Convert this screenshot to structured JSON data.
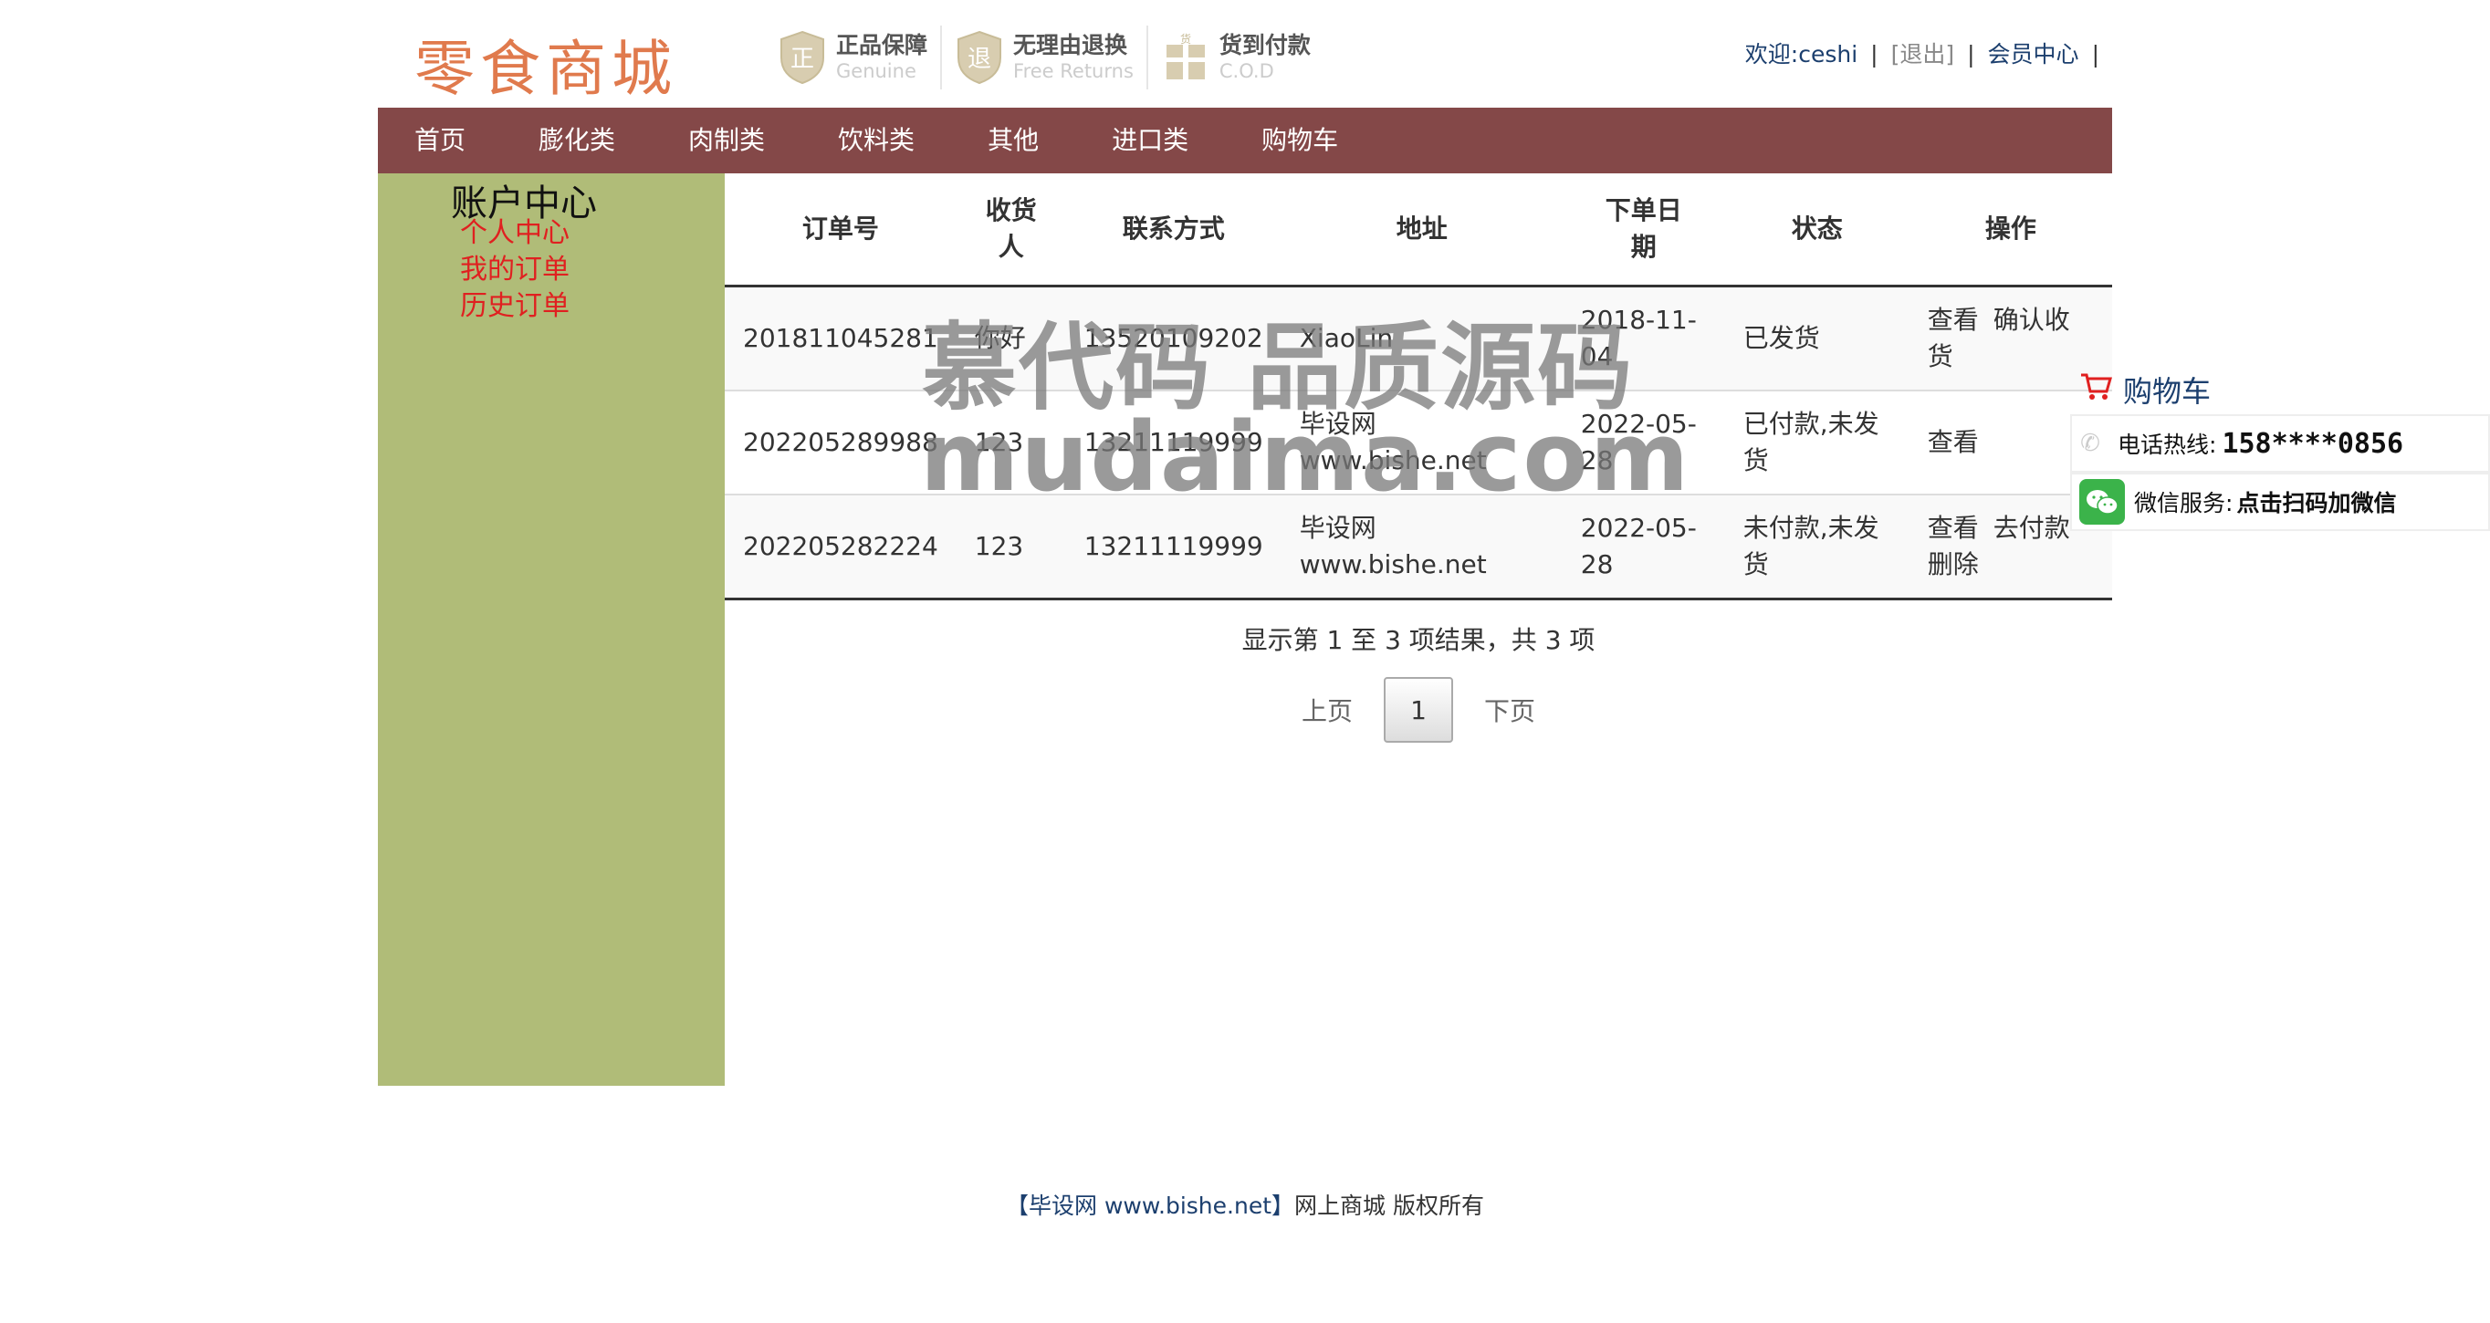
{
  "header": {
    "logo": "零食商城",
    "badges": [
      {
        "glyph": "正",
        "title": "正品保障",
        "sub": "Genuine"
      },
      {
        "glyph": "退",
        "title": "无理由退换",
        "sub": "Free Returns"
      },
      {
        "glyph": "货",
        "title": "货到付款",
        "sub": "C.O.D"
      }
    ],
    "welcome": "欢迎:ceshi",
    "logout": "[退出]",
    "member_center": "会员中心"
  },
  "nav": [
    "首页",
    "膨化类",
    "肉制类",
    "饮料类",
    "其他",
    "进口类",
    "购物车"
  ],
  "sidebar": {
    "title": "账户中心",
    "links": [
      "个人中心",
      "我的订单",
      "历史订单"
    ]
  },
  "table": {
    "headers": [
      "订单号",
      "收货人",
      "联系方式",
      "地址",
      "下单日期",
      "状态",
      "操作"
    ],
    "rows": [
      {
        "order_no": "201811045281",
        "receiver": "你好",
        "phone": "13520109202",
        "address": "XiaoLin",
        "date": "2018-11-04",
        "status": "已发货",
        "ops": [
          "查看",
          "确认收货"
        ]
      },
      {
        "order_no": "202205289988",
        "receiver": "123",
        "phone": "13211119999",
        "address": "毕设网 www.bishe.net",
        "date": "2022-05-28",
        "status": "已付款,未发货",
        "ops": [
          "查看"
        ]
      },
      {
        "order_no": "202205282224",
        "receiver": "123",
        "phone": "13211119999",
        "address": "毕设网 www.bishe.net",
        "date": "2022-05-28",
        "status": "未付款,未发货",
        "ops": [
          "查看",
          "去付款",
          "删除"
        ]
      }
    ]
  },
  "pagination": {
    "info": "显示第 1 至 3 项结果，共 3 项",
    "prev": "上页",
    "current": "1",
    "next": "下页"
  },
  "watermark": {
    "line1": "慕代码 品质源码",
    "line2": "mudaima.com"
  },
  "float": {
    "cart": "购物车",
    "phone_label": "电话热线:",
    "phone_value": "158****0856",
    "wechat_label": "微信服务:",
    "wechat_value": "点击扫码加微信"
  },
  "footer": {
    "link": "【毕设网 www.bishe.net】",
    "text": "网上商城 版权所有"
  },
  "colors": {
    "nav_bg": "#844848",
    "sidebar_bg": "#b0bc78",
    "sidebar_link": "#e02020",
    "link_blue": "#1c3f6e"
  }
}
